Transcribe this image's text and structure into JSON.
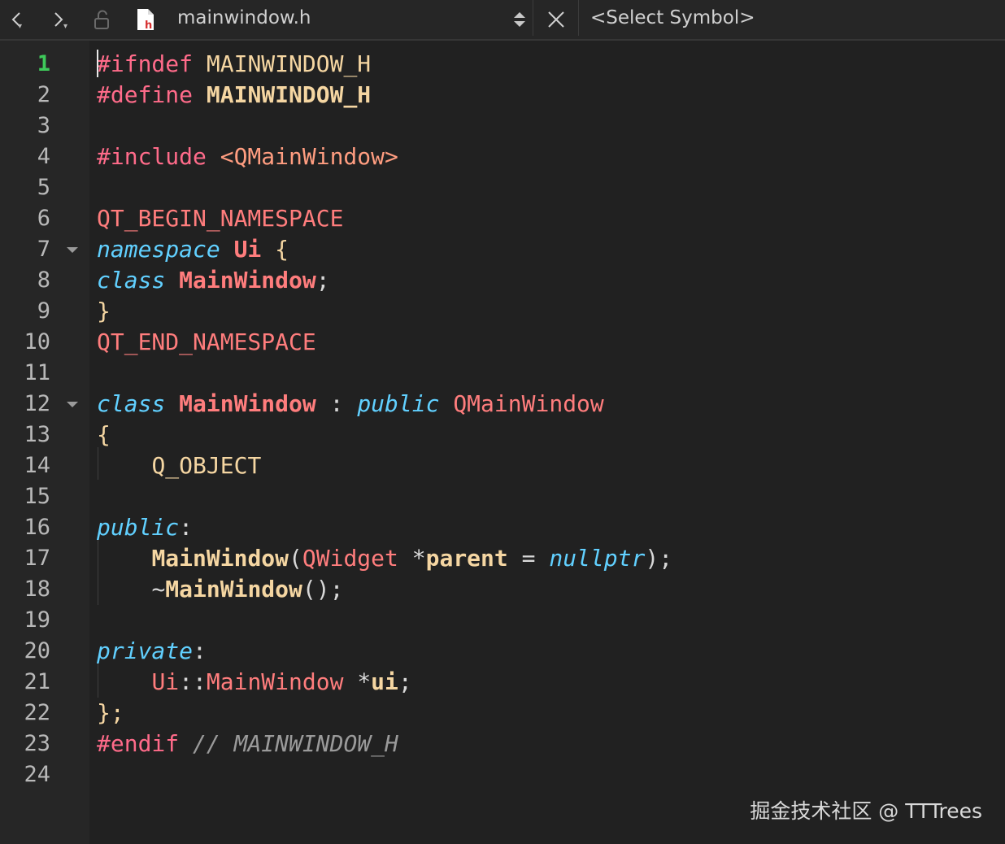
{
  "toolbar": {
    "file_name": "mainwindow.h",
    "symbol_select": "<Select Symbol>",
    "icons": [
      "back-icon",
      "forward-icon",
      "lock-icon",
      "header-file-icon",
      "sort-arrows-icon",
      "close-icon"
    ]
  },
  "editor": {
    "current_line": 1,
    "line_numbers": [
      "1",
      "2",
      "3",
      "4",
      "5",
      "6",
      "7",
      "8",
      "9",
      "10",
      "11",
      "12",
      "13",
      "14",
      "15",
      "16",
      "17",
      "18",
      "19",
      "20",
      "21",
      "22",
      "23",
      "24"
    ],
    "tokens": {
      "l1": [
        "#ifndef",
        "MAINWINDOW_H"
      ],
      "l2": [
        "#define",
        "MAINWINDOW_H"
      ],
      "l4": [
        "#include",
        "<QMainWindow>"
      ],
      "l6": [
        "QT_BEGIN_NAMESPACE"
      ],
      "l7": [
        "namespace",
        "Ui",
        "{"
      ],
      "l8": [
        "class",
        "MainWindow",
        ";"
      ],
      "l9": [
        "}"
      ],
      "l10": [
        "QT_END_NAMESPACE"
      ],
      "l12": [
        "class",
        "MainWindow",
        ":",
        "public",
        "QMainWindow"
      ],
      "l13": [
        "{"
      ],
      "l14": [
        "Q_OBJECT"
      ],
      "l16": [
        "public",
        ":"
      ],
      "l17": [
        "MainWindow",
        "(",
        "QWidget",
        "*",
        "parent",
        "=",
        "nullptr",
        ");"
      ],
      "l18": [
        "~",
        "MainWindow",
        "();"
      ],
      "l20": [
        "private",
        ":"
      ],
      "l21": [
        "Ui",
        "::",
        "MainWindow",
        "*",
        "ui",
        ";"
      ],
      "l22": [
        "};"
      ],
      "l23": [
        "#endif",
        "// MAINWINDOW_H"
      ]
    }
  },
  "watermark": "掘金技术社区 @ TTTrees",
  "colors": {
    "background": "#212121",
    "gutter": "#262626",
    "current_line_number": "#3ec95a",
    "preprocessor": "#ff6b8a",
    "keyword": "#61d0ff",
    "class_name": "#ff7d7d",
    "function": "#f5d6a2",
    "comment": "#9a9a9a"
  }
}
